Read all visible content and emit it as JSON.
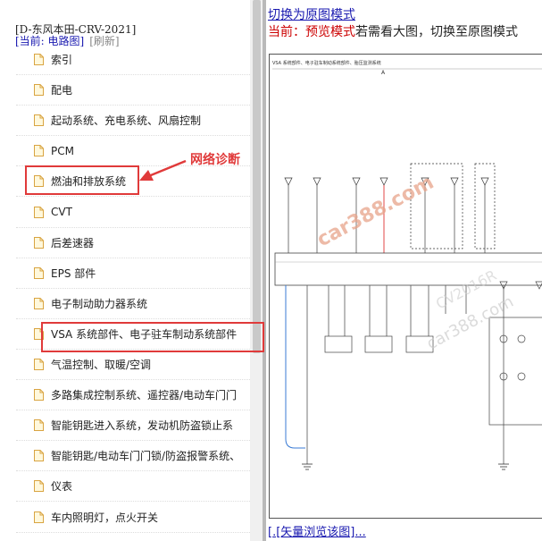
{
  "breadcrumb": "[D-东风本田-CRV-2021]",
  "status": {
    "current": "[当前: 电路图]",
    "refresh": "[刷新]"
  },
  "tree_items": [
    "索引",
    "配电",
    "起动系统、充电系统、风扇控制",
    "PCM",
    "燃油和排放系统",
    "CVT",
    "后差速器",
    "EPS 部件",
    "电子制动助力器系统",
    "VSA 系统部件、电子驻车制动系统部件",
    "气温控制、取暖/空调",
    "多路集成控制系统、遥控器/电动车门门",
    "智能钥匙进入系统，发动机防盗锁止系",
    "智能钥匙/电动车门门锁/防盗报警系统、",
    "仪表",
    "车内照明灯，点火开关"
  ],
  "annotation": {
    "label": "网络诊断",
    "color": "#e03a3a"
  },
  "preview": {
    "switch_link": "切换为原图模式",
    "mode_prefix": "当前：",
    "mode_name": "预览模式",
    "mode_suffix": "若需看大图，切换至原图模式",
    "vector_prefix": "[",
    "vector_link": ".[矢量浏览该图]..."
  },
  "diagram": {
    "title": "VSA 系统部件、电子驻车制动系统部件、胎压监测系统",
    "column_marker": "A",
    "watermarks": [
      "car388.com",
      "car388.com",
      "CV2016R"
    ]
  }
}
